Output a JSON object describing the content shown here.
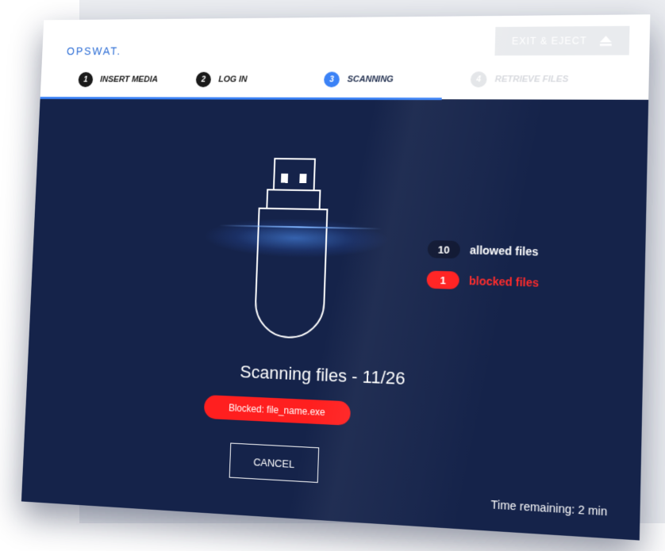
{
  "header": {
    "logo": "OPSWAT.",
    "eject_label": "EXIT & EJECT",
    "eject_icon": "eject-icon"
  },
  "steps": [
    {
      "number": "1",
      "label": "INSERT MEDIA",
      "state": "done"
    },
    {
      "number": "2",
      "label": "LOG IN",
      "state": "done"
    },
    {
      "number": "3",
      "label": "SCANNING",
      "state": "active"
    },
    {
      "number": "4",
      "label": "RETRIEVE FILES",
      "state": "future"
    }
  ],
  "counters": {
    "allowed_count": "10",
    "allowed_label": "allowed files",
    "blocked_count": "1",
    "blocked_label": "blocked files"
  },
  "scan": {
    "status": "Scanning files - 11/26",
    "blocked_message": "Blocked: file_name.exe",
    "cancel_label": "CANCEL",
    "time_remaining": "Time remaining: 2 min",
    "progress_fraction": 0.68
  },
  "colors": {
    "accent": "#3b82f6",
    "background": "#15234a",
    "blocked": "#ff1f1f"
  },
  "icons": {
    "device": "usb-drive-icon"
  }
}
